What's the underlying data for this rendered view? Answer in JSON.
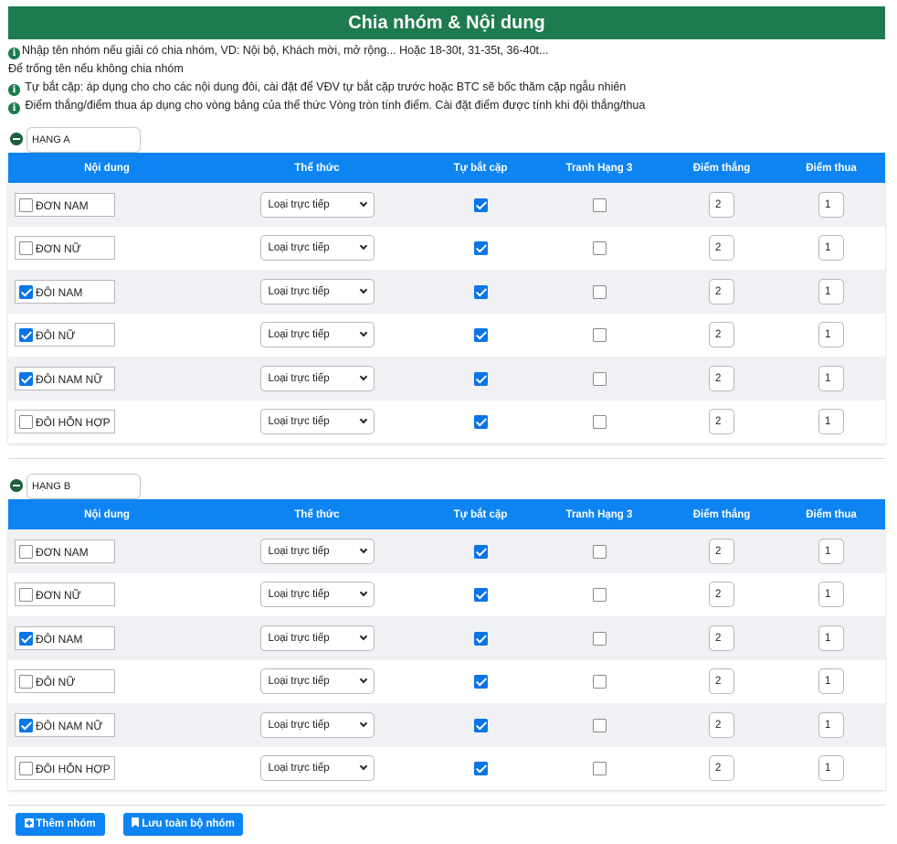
{
  "title": "Chia nhóm & Nội dung",
  "info": [
    "Nhập tên nhóm nếu giải có chia nhóm, VD: Nội bộ, Khách mời, mở rộng... Hoặc 18-30t, 31-35t, 36-40t...",
    "Để trống tên nếu không chia nhóm",
    "Tự bắt cặp: áp dụng cho cho các nội dung đôi, cài đặt để VĐV tự bắt cặp trước hoặc BTC sẽ bốc thăm cặp ngẫu nhiên",
    "Điểm thắng/điểm thua áp dụng cho vòng bảng của thể thức Vòng tròn tính điểm. Cài đặt điểm được tính khi đội thắng/thua"
  ],
  "columns": [
    "Nội dung",
    "Thể thức",
    "Tự bắt cặp",
    "Tranh Hạng 3",
    "Điểm thắng",
    "Điểm thua"
  ],
  "groups": [
    {
      "name": "HẠNG A",
      "rows": [
        {
          "content": "ĐƠN NAM",
          "selected": false,
          "format": "Loại trực tiếp",
          "auto_pair": true,
          "third_place": false,
          "win": "2",
          "lose": "1"
        },
        {
          "content": "ĐƠN NỮ",
          "selected": false,
          "format": "Loại trực tiếp",
          "auto_pair": true,
          "third_place": false,
          "win": "2",
          "lose": "1"
        },
        {
          "content": "ĐÔI NAM",
          "selected": true,
          "format": "Loại trực tiếp",
          "auto_pair": true,
          "third_place": false,
          "win": "2",
          "lose": "1"
        },
        {
          "content": "ĐÔI NỮ",
          "selected": true,
          "format": "Loại trực tiếp",
          "auto_pair": true,
          "third_place": false,
          "win": "2",
          "lose": "1"
        },
        {
          "content": "ĐÔI NAM NỮ",
          "selected": true,
          "format": "Loại trực tiếp",
          "auto_pair": true,
          "third_place": false,
          "win": "2",
          "lose": "1"
        },
        {
          "content": "ĐÔI HỖN HỢP",
          "selected": false,
          "format": "Loại trực tiếp",
          "auto_pair": true,
          "third_place": false,
          "win": "2",
          "lose": "1"
        }
      ]
    },
    {
      "name": "HẠNG B",
      "rows": [
        {
          "content": "ĐƠN NAM",
          "selected": false,
          "format": "Loại trực tiếp",
          "auto_pair": true,
          "third_place": false,
          "win": "2",
          "lose": "1"
        },
        {
          "content": "ĐƠN NỮ",
          "selected": false,
          "format": "Loại trực tiếp",
          "auto_pair": true,
          "third_place": false,
          "win": "2",
          "lose": "1"
        },
        {
          "content": "ĐÔI NAM",
          "selected": true,
          "format": "Loại trực tiếp",
          "auto_pair": true,
          "third_place": false,
          "win": "2",
          "lose": "1"
        },
        {
          "content": "ĐÔI NỮ",
          "selected": false,
          "format": "Loại trực tiếp",
          "auto_pair": true,
          "third_place": false,
          "win": "2",
          "lose": "1"
        },
        {
          "content": "ĐÔI NAM NỮ",
          "selected": true,
          "format": "Loại trực tiếp",
          "auto_pair": true,
          "third_place": false,
          "win": "2",
          "lose": "1"
        },
        {
          "content": "ĐÔI HỖN HỢP",
          "selected": false,
          "format": "Loại trực tiếp",
          "auto_pair": true,
          "third_place": false,
          "win": "2",
          "lose": "1"
        }
      ]
    }
  ],
  "buttons": {
    "add_group": "Thêm nhóm",
    "save_all": "Lưu toàn bộ nhóm"
  },
  "colors": {
    "header_green": "#1e7a4f",
    "table_header_blue": "#0d84f2",
    "checkbox_blue": "#0b75e6"
  }
}
